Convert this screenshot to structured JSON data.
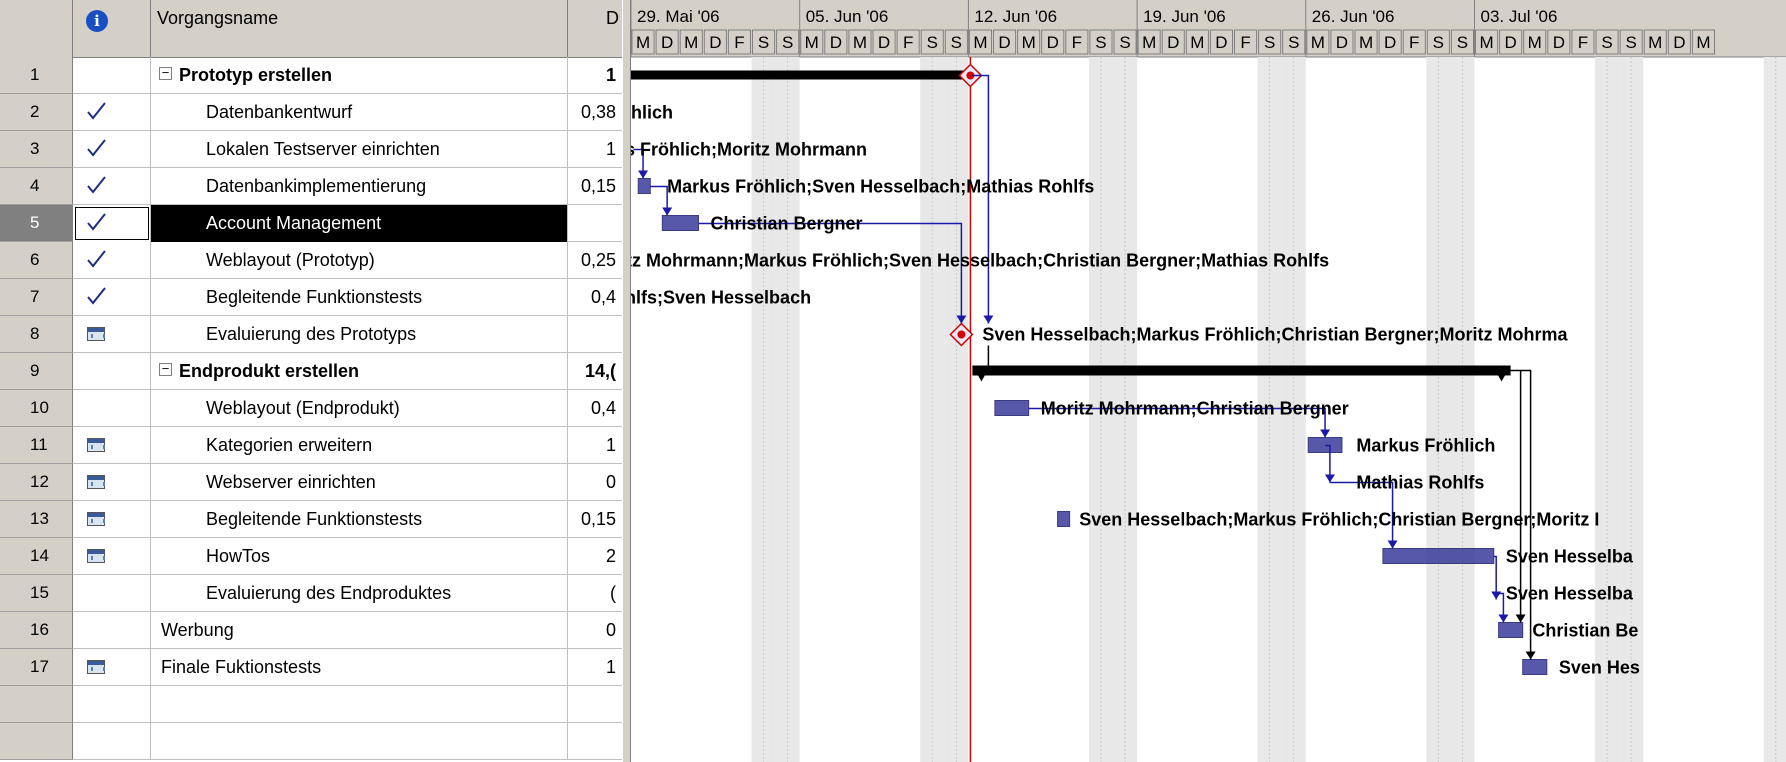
{
  "header": {
    "info_icon": "info-icon",
    "name_col": "Vorgangsname",
    "dur_col": "D"
  },
  "tasks": [
    {
      "id": "1",
      "name": "Prototyp erstellen",
      "dur": "1",
      "summary": true,
      "indicator": "",
      "level": 0
    },
    {
      "id": "2",
      "name": "Datenbankentwurf",
      "dur": "0,38",
      "summary": false,
      "indicator": "check-icon",
      "level": 1
    },
    {
      "id": "3",
      "name": "Lokalen Testserver einrichten",
      "dur": "1",
      "summary": false,
      "indicator": "check-icon",
      "level": 1
    },
    {
      "id": "4",
      "name": "Datenbankimplementierung",
      "dur": "0,15",
      "summary": false,
      "indicator": "check-icon",
      "level": 1
    },
    {
      "id": "5",
      "name": "Account Management",
      "dur": "",
      "summary": false,
      "indicator": "check-icon",
      "level": 1,
      "selected": true
    },
    {
      "id": "6",
      "name": "Weblayout (Prototyp)",
      "dur": "0,25",
      "summary": false,
      "indicator": "check-icon",
      "level": 1
    },
    {
      "id": "7",
      "name": "Begleitende Funktionstests",
      "dur": "0,4",
      "summary": false,
      "indicator": "check-icon",
      "level": 1
    },
    {
      "id": "8",
      "name": "Evaluierung des Prototyps",
      "dur": "",
      "summary": false,
      "indicator": "calendar-icon",
      "level": 1
    },
    {
      "id": "9",
      "name": "Endprodukt erstellen",
      "dur": "14,(",
      "summary": true,
      "indicator": "",
      "level": 0
    },
    {
      "id": "10",
      "name": "Weblayout (Endprodukt)",
      "dur": "0,4",
      "summary": false,
      "indicator": "",
      "level": 1
    },
    {
      "id": "11",
      "name": "Kategorien erweitern",
      "dur": "1",
      "summary": false,
      "indicator": "calendar-icon",
      "level": 1
    },
    {
      "id": "12",
      "name": "Webserver einrichten",
      "dur": "0",
      "summary": false,
      "indicator": "calendar-icon",
      "level": 1
    },
    {
      "id": "13",
      "name": "Begleitende Funktionstests",
      "dur": "0,15",
      "summary": false,
      "indicator": "calendar-icon",
      "level": 1
    },
    {
      "id": "14",
      "name": "HowTos",
      "dur": "2",
      "summary": false,
      "indicator": "calendar-icon",
      "level": 1
    },
    {
      "id": "15",
      "name": "Evaluierung des Endproduktes",
      "dur": "(",
      "summary": false,
      "indicator": "",
      "level": 1
    },
    {
      "id": "16",
      "name": "Werbung",
      "dur": "0",
      "summary": false,
      "indicator": "",
      "level": 0
    },
    {
      "id": "17",
      "name": "Finale Fuktionstests",
      "dur": "1",
      "summary": false,
      "indicator": "calendar-icon",
      "level": 0
    }
  ],
  "timescale": {
    "weeks": [
      "29. Mai '06",
      "05. Jun '06",
      "12. Jun '06",
      "19. Jun '06",
      "26. Jun '06",
      "03. Jul '06"
    ],
    "days": [
      "M",
      "D",
      "M",
      "D",
      "F",
      "S",
      "S"
    ]
  },
  "gantt_labels": [
    "hlich",
    "s Fröhlich;Moritz Mohrmann",
    "Markus Fröhlich;Sven Hesselbach;Mathias Rohlfs",
    "Christian Bergner",
    "itz Mohrmann;Markus Fröhlich;Sven Hesselbach;Christian Bergner;Mathias Rohlfs",
    "hlfs;Sven Hesselbach",
    "Sven Hesselbach;Markus Fröhlich;Christian Bergner;Moritz Mohrma",
    "",
    "Moritz Mohrmann;Christian Bergner",
    "Markus Fröhlich",
    "Mathias Rohlfs",
    "Sven Hesselbach;Markus Fröhlich;Christian Bergner;Moritz I",
    "Sven Hesselba",
    "Sven Hesselba",
    "Christian Be",
    "Sven Hes"
  ],
  "colors": {
    "bar": "#3b3b9c",
    "link": "#1a1aa8",
    "summary": "#000000",
    "today_line": "#d40000",
    "weekend": "#e8e8e8",
    "header_bg": "#d4d0c8"
  }
}
